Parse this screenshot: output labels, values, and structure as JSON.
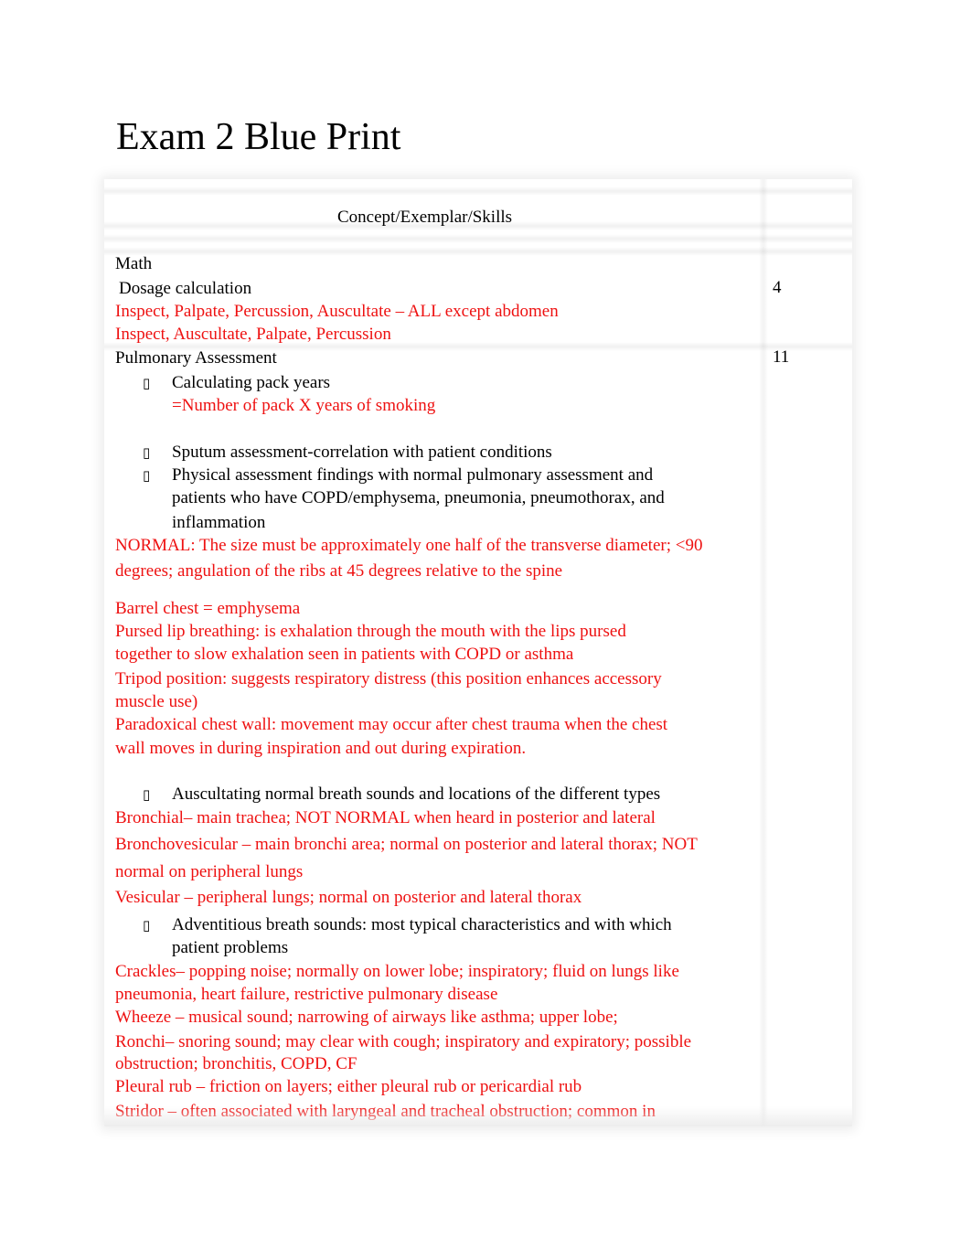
{
  "document": {
    "title": "Exam 2 Blue Print",
    "table": {
      "header": "Concept/Exemplar/Skills",
      "sections": [
        {
          "name": "Math",
          "items": [
            {
              "text": "Dosage calculation",
              "count": "4"
            }
          ],
          "notes": [
            "Inspect, Palpate, Percussion, Auscultate – ALL except abdomen",
            "Inspect, Auscultate, Palpate, Percussion"
          ]
        },
        {
          "name": "Pulmonary Assessment",
          "count": "11",
          "bullet_glyph": "▯",
          "bullets": [
            {
              "lines": [
                "Calculating pack years"
              ],
              "notes": [
                "=Number of pack X years of smoking"
              ]
            },
            {
              "lines": [
                "Sputum assessment-correlation with patient conditions"
              ]
            },
            {
              "lines": [
                "Physical assessment findings with normal pulmonary assessment and",
                "patients who   have COPD/emphysema, pneumonia, pneumothorax, and",
                "inflammation"
              ],
              "notes": [
                "NORMAL: The size must be approximately one half of the transverse diameter; <90",
                "degrees; angulation of the ribs at 45 degrees relative to the spine",
                "Barrel chest = emphysema",
                "Pursed lip breathing:  is exhalation through the mouth with the lips pursed",
                "together to slow exhalation seen in patients with COPD or asthma",
                "Tripod position: suggests respiratory distress (this position enhances accessory",
                "muscle use)",
                "Paradoxical chest wall: movement may occur after chest trauma when the chest",
                "wall moves in during inspiration and out during expiration."
              ]
            },
            {
              "lines": [
                "Auscultating normal breath sounds and locations of the different types"
              ],
              "notes": [
                "Bronchial– main trachea; NOT NORMAL when heard in posterior and lateral",
                "Bronchovesicular – main bronchi area; normal on posterior and lateral thorax; NOT",
                "normal on peripheral lungs",
                "Vesicular – peripheral lungs; normal on posterior and lateral thorax"
              ]
            },
            {
              "lines": [
                "Adventitious breath sounds: most typical characteristics and with which",
                "patient problems"
              ],
              "notes": [
                "Crackles– popping noise; normally on lower lobe; inspiratory; fluid on lungs like",
                "pneumonia, heart failure, restrictive pulmonary disease",
                "Wheeze – musical sound; narrowing of airways like asthma; upper lobe;",
                "Ronchi– snoring sound; may clear with cough; inspiratory and expiratory; possible",
                "obstruction; bronchitis, COPD, CF",
                "Pleural rub – friction on layers; either pleural rub or pericardial rub",
                "Stridor – often associated with laryngeal and tracheal obstruction; common in"
              ]
            }
          ]
        }
      ]
    }
  },
  "colors": {
    "note_red": "#ee1111",
    "text": "#000000"
  }
}
